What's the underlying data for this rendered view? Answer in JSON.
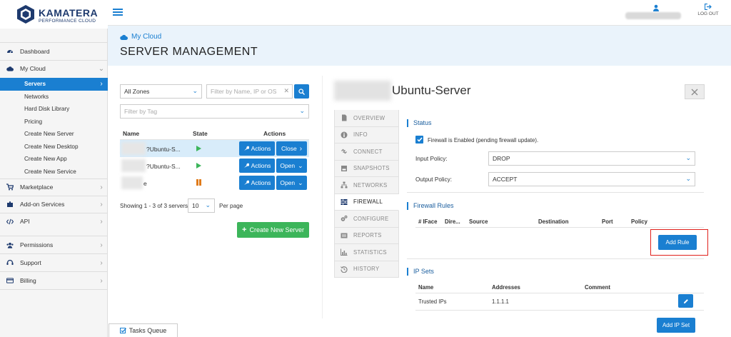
{
  "brand": {
    "name": "KAMATERA",
    "subtitle": "PERFORMANCE CLOUD"
  },
  "topbar": {
    "logout_label": "LOG OUT"
  },
  "sidebar": {
    "items": [
      {
        "label": "Dashboard",
        "icon": "dashboard-icon"
      },
      {
        "label": "My Cloud",
        "icon": "cloud-icon",
        "expanded": true
      },
      {
        "label": "Marketplace",
        "icon": "cart-icon"
      },
      {
        "label": "Add-on Services",
        "icon": "puzzle-icon"
      },
      {
        "label": "API",
        "icon": "code-icon"
      },
      {
        "label": "Permissions",
        "icon": "users-icon"
      },
      {
        "label": "Support",
        "icon": "headset-icon"
      },
      {
        "label": "Billing",
        "icon": "card-icon"
      }
    ],
    "cloud_subitems": [
      {
        "label": "Servers",
        "active": true
      },
      {
        "label": "Networks"
      },
      {
        "label": "Hard Disk Library"
      },
      {
        "label": "Pricing"
      },
      {
        "label": "Create New Server"
      },
      {
        "label": "Create New Desktop"
      },
      {
        "label": "Create New App"
      },
      {
        "label": "Create New Service"
      }
    ]
  },
  "header": {
    "breadcrumb": "My Cloud",
    "title": "SERVER MANAGEMENT"
  },
  "servers": {
    "zone_select": "All Zones",
    "filter_placeholder": "Filter by Name, IP or OS",
    "tag_placeholder": "Filter by Tag",
    "columns": {
      "name": "Name",
      "state": "State",
      "actions": "Actions"
    },
    "rows": [
      {
        "name": "?Ubuntu-S...",
        "state": "stopped",
        "actions_label": "Actions",
        "toggle_label": "Close",
        "selected": true
      },
      {
        "name": "?Ubuntu-S...",
        "state": "stopped",
        "actions_label": "Actions",
        "toggle_label": "Open"
      },
      {
        "name": "e",
        "state": "paused",
        "actions_label": "Actions",
        "toggle_label": "Open"
      }
    ],
    "pagination_text": "Showing 1 - 3 of 3 servers,",
    "per_page_value": "10",
    "per_page_label": "Per page",
    "create_button": "Create New Server"
  },
  "detail": {
    "server_title": "Ubuntu-Server",
    "tabs": [
      {
        "label": "OVERVIEW",
        "icon": "document-icon"
      },
      {
        "label": "INFO",
        "icon": "info-icon"
      },
      {
        "label": "CONNECT",
        "icon": "link-icon"
      },
      {
        "label": "SNAPSHOTS",
        "icon": "snapshot-icon"
      },
      {
        "label": "NETWORKS",
        "icon": "network-icon"
      },
      {
        "label": "FIREWALL",
        "icon": "firewall-icon",
        "active": true
      },
      {
        "label": "CONFIGURE",
        "icon": "gears-icon"
      },
      {
        "label": "REPORTS",
        "icon": "reports-icon"
      },
      {
        "label": "STATISTICS",
        "icon": "chart-icon"
      },
      {
        "label": "HISTORY",
        "icon": "history-icon"
      }
    ],
    "status": {
      "title": "Status",
      "checkbox_label": "Firewall is Enabled (pending firewall update).",
      "input_policy_label": "Input Policy:",
      "input_policy_value": "DROP",
      "output_policy_label": "Output Policy:",
      "output_policy_value": "ACCEPT"
    },
    "rules": {
      "title": "Firewall Rules",
      "columns": [
        "# IFace",
        "Dire...",
        "Source",
        "Destination",
        "Port",
        "Policy"
      ],
      "add_button": "Add Rule",
      "highlight_color": "#e0201b"
    },
    "ipsets": {
      "title": "IP Sets",
      "columns": [
        "Name",
        "Addresses",
        "Comment"
      ],
      "rows": [
        {
          "name": "Trusted IPs",
          "addresses": "1.1.1.1",
          "comment": ""
        }
      ],
      "add_button": "Add IP Set"
    }
  },
  "tasks_queue": {
    "label": "Tasks Queue"
  },
  "colors": {
    "accent": "#1a7fd1",
    "success": "#3cb55a",
    "stopped": "#3cb55a",
    "paused": "#e07b1a",
    "brand": "#1e3a6e"
  }
}
